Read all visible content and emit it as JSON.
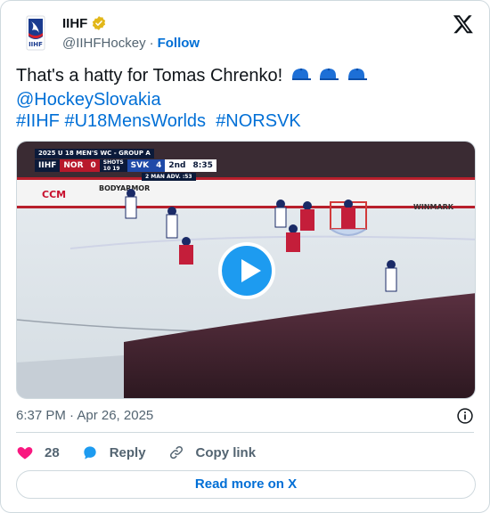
{
  "author": {
    "name": "IIHF",
    "handle": "@IIHFHockey",
    "separator": "·",
    "follow_label": "Follow",
    "avatar_text": "IIHF"
  },
  "tweet": {
    "text_line1": "That's a hatty for Tomas Chrenko!",
    "emoji_icons": [
      "cap-icon",
      "cap-icon",
      "cap-icon"
    ],
    "mention": "@HockeySlovakia",
    "hashtags": [
      "#IIHF",
      "#U18MensWorlds",
      "#NORSVK"
    ]
  },
  "media": {
    "type": "video",
    "scoreboard": {
      "header": "2025 U 18 MEN'S WC - GROUP A",
      "league": "IIHF",
      "team1": "NOR",
      "team1_score": "0",
      "shots_label": "SHOTS",
      "shots1": "10",
      "shots2": "19",
      "team2": "SVK",
      "team2_score": "4",
      "period": "2nd",
      "clock": "8:35",
      "situation": "2 MAN ADV.",
      "situation_time": ":53"
    },
    "boards": {
      "sponsor1": "CCM",
      "sponsor2": "BODYARMOR",
      "sponsor3": "WINMARK"
    }
  },
  "meta": {
    "timestamp": "6:37 PM · Apr 26, 2025"
  },
  "actions": {
    "like_count": "28",
    "reply_label": "Reply",
    "copy_label": "Copy link"
  },
  "read_more_label": "Read more on X",
  "colors": {
    "link": "#006fd6",
    "like": "#f91880",
    "play": "#1d9bf0",
    "text": "#0f1419",
    "muted": "#536471",
    "border": "#cfd9de"
  }
}
